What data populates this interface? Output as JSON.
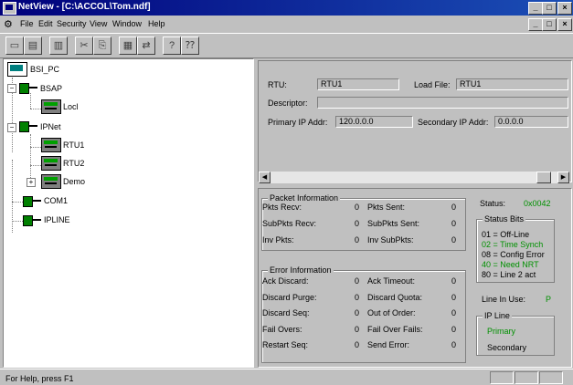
{
  "window": {
    "title": "NetView - [C:\\ACCOL\\Tom.ndf]",
    "controls": {
      "minimize": "_",
      "restore": "□",
      "close": "×"
    }
  },
  "menu": {
    "items": [
      "File",
      "Edit",
      "Security",
      "View",
      "Window",
      "Help"
    ],
    "mdi_controls": {
      "minimize": "_",
      "restore": "□",
      "close": "×"
    }
  },
  "toolbar": {
    "buttons": [
      "new-icon",
      "open-icon",
      "print-icon",
      "cut-icon",
      "copy-icon",
      "properties-icon",
      "transfer-icon",
      "help-icon",
      "context-help-icon"
    ]
  },
  "tree": {
    "root": "BSI_PC",
    "nodes": [
      {
        "label": "BSAP",
        "children": [
          "Locl"
        ]
      },
      {
        "label": "IPNet",
        "children": [
          "RTU1",
          "RTU2",
          "Demo"
        ]
      },
      {
        "label": "COM1",
        "children": []
      },
      {
        "label": "IPLINE",
        "children": []
      }
    ]
  },
  "details": {
    "rtu_label": "RTU:",
    "rtu_value": "RTU1",
    "load_file_label": "Load File:",
    "load_file_value": "RTU1",
    "descriptor_label": "Descriptor:",
    "descriptor_value": "",
    "primary_ip_label": "Primary IP Addr:",
    "primary_ip_value": "120.0.0.0",
    "secondary_ip_label": "Secondary IP Addr:",
    "secondary_ip_value": "0.0.0.0"
  },
  "packet_info": {
    "title": "Packet Information",
    "rows": [
      {
        "l1": "Pkts Recv:",
        "v1": "0",
        "l2": "Pkts Sent:",
        "v2": "0"
      },
      {
        "l1": "SubPkts Recv:",
        "v1": "0",
        "l2": "SubPkts Sent:",
        "v2": "0"
      },
      {
        "l1": "Inv Pkts:",
        "v1": "0",
        "l2": "Inv SubPkts:",
        "v2": "0"
      }
    ]
  },
  "error_info": {
    "title": "Error Information",
    "rows": [
      {
        "l1": "Ack Discard:",
        "v1": "0",
        "l2": "Ack Timeout:",
        "v2": "0"
      },
      {
        "l1": "Discard Purge:",
        "v1": "0",
        "l2": "Discard Quota:",
        "v2": "0"
      },
      {
        "l1": "Discard Seq:",
        "v1": "0",
        "l2": "Out of Order:",
        "v2": "0"
      },
      {
        "l1": "Fail Overs:",
        "v1": "0",
        "l2": "Fail Over Fails:",
        "v2": "0"
      },
      {
        "l1": "Restart Seq:",
        "v1": "0",
        "l2": "Send Error:",
        "v2": "0"
      }
    ]
  },
  "status": {
    "label": "Status:",
    "value": "0x0042",
    "bits_title": "Status Bits",
    "bits": [
      {
        "text": "01 = Off-Line",
        "active": false
      },
      {
        "text": "02 = Time Synch",
        "active": true
      },
      {
        "text": "08 = Config Error",
        "active": false
      },
      {
        "text": "40 = Need NRT",
        "active": true
      },
      {
        "text": "80 = Line 2 act",
        "active": false
      }
    ],
    "line_in_use_label": "Line In Use:",
    "line_in_use_value": "P",
    "ip_line_title": "IP Line",
    "ip_line_primary": "Primary",
    "ip_line_secondary": "Secondary"
  },
  "statusbar": {
    "text": "For Help, press F1"
  },
  "colors": {
    "title_start": "#00007b",
    "title_end": "#1b4fb6",
    "active_green": "#009000",
    "face": "#c0c0c0"
  }
}
